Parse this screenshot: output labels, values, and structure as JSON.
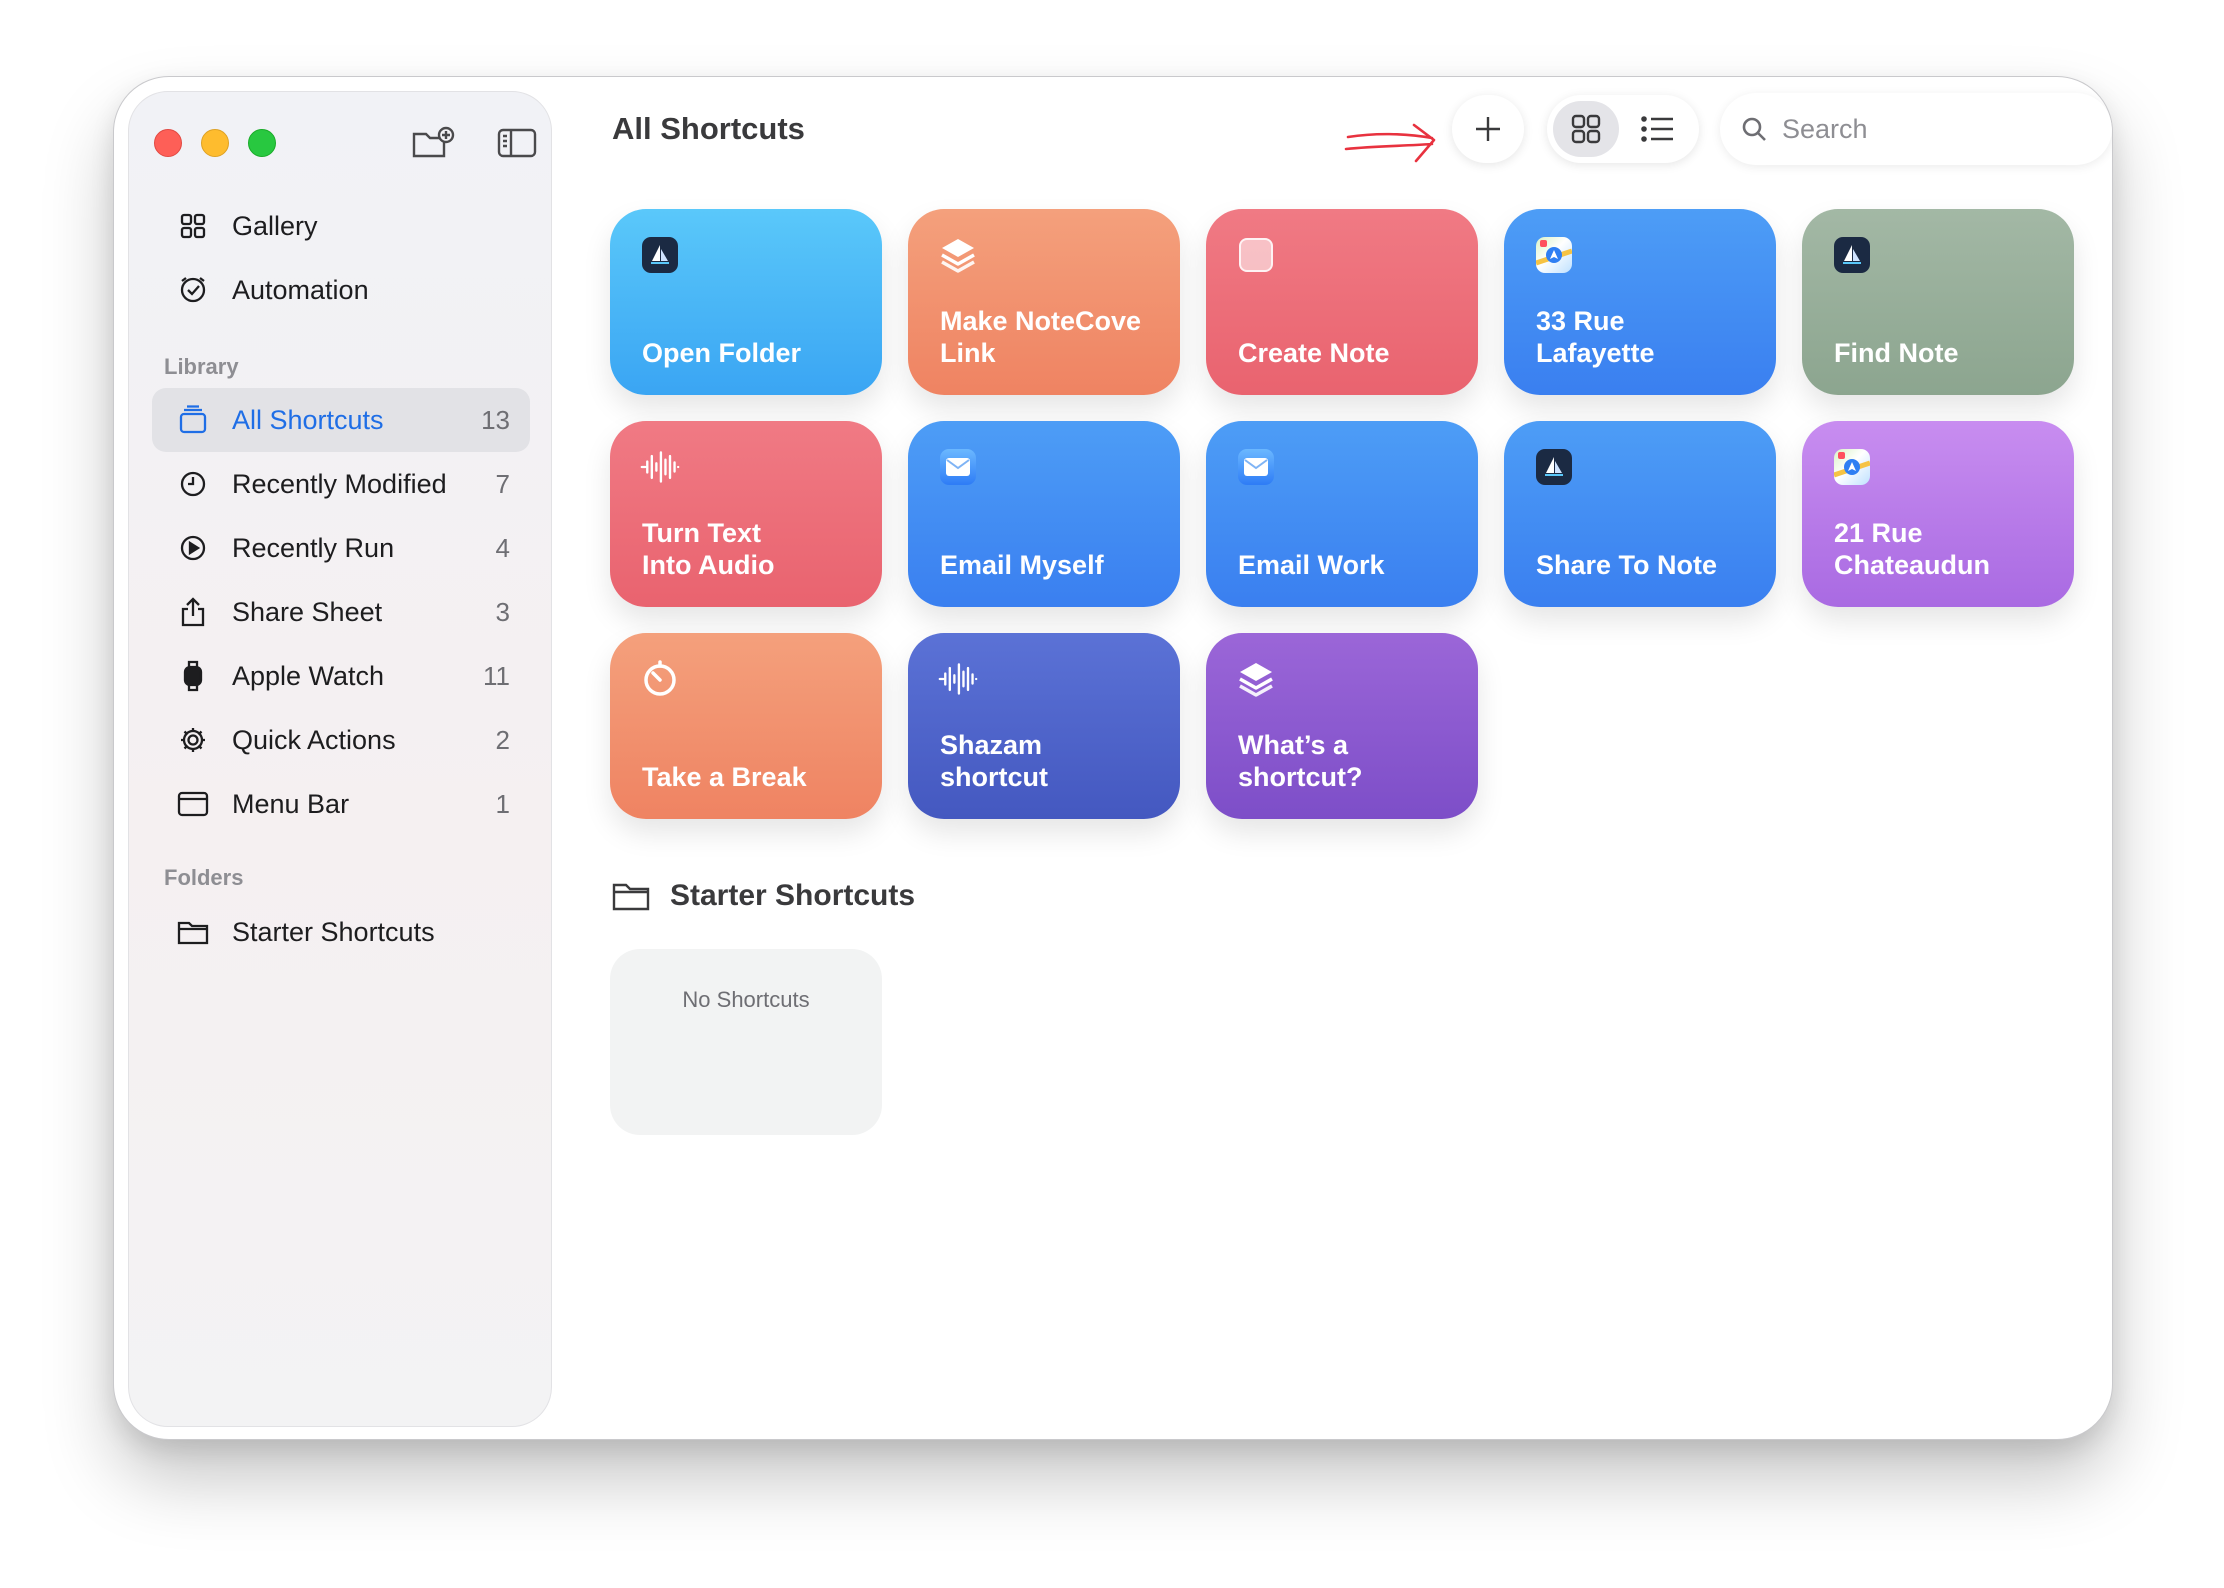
{
  "window": {
    "traffic_lights": [
      "close",
      "minimize",
      "zoom"
    ]
  },
  "sidebar": {
    "toolbar": {
      "new_folder_icon": "folder-badge-plus-icon",
      "toggle_sidebar_icon": "sidebar-left-icon"
    },
    "top_items": [
      {
        "label": "Gallery",
        "icon": "gallery-grid-icon"
      },
      {
        "label": "Automation",
        "icon": "automation-clock-icon"
      }
    ],
    "library_label": "Library",
    "library_items": [
      {
        "label": "All Shortcuts",
        "count": "13",
        "icon": "stack-icon",
        "active": true
      },
      {
        "label": "Recently Modified",
        "count": "7",
        "icon": "clock-icon"
      },
      {
        "label": "Recently Run",
        "count": "4",
        "icon": "play-circle-icon"
      },
      {
        "label": "Share Sheet",
        "count": "3",
        "icon": "share-icon"
      },
      {
        "label": "Apple Watch",
        "count": "11",
        "icon": "watch-icon"
      },
      {
        "label": "Quick Actions",
        "count": "2",
        "icon": "gear-icon"
      },
      {
        "label": "Menu Bar",
        "count": "1",
        "icon": "menu-bar-icon"
      }
    ],
    "folders_label": "Folders",
    "folder_items": [
      {
        "label": "Starter Shortcuts",
        "icon": "folder-icon"
      }
    ]
  },
  "header": {
    "title": "All Shortcuts",
    "annotation_color": "#e8323f",
    "add_icon": "plus-icon",
    "grid_view_icon": "grid-view-icon",
    "list_view_icon": "list-view-icon",
    "search_placeholder": "Search",
    "search_value": ""
  },
  "shortcuts": [
    {
      "label": "Open Folder",
      "color_start": "#5ac8fa",
      "color_end": "#3aa5f3",
      "icon": "sailboat-app-icon"
    },
    {
      "label": "Make NoteCove\nLink",
      "color_start": "#f4a07c",
      "color_end": "#ef8362",
      "icon": "layers-icon"
    },
    {
      "label": "Create Note",
      "color_start": "#f07a84",
      "color_end": "#e9636f",
      "icon": "notes-app-icon"
    },
    {
      "label": "33 Rue\nLafayette",
      "color_start": "#4d9df6",
      "color_end": "#3a7ff0",
      "icon": "maps-app-icon"
    },
    {
      "label": "Find Note",
      "color_start": "#a3b8a5",
      "color_end": "#8ca58f",
      "icon": "sailboat-app-icon"
    },
    {
      "label": "Turn Text\nInto Audio",
      "color_start": "#f07a84",
      "color_end": "#e9636f",
      "icon": "waveform-icon"
    },
    {
      "label": "Email Myself",
      "color_start": "#4d9df6",
      "color_end": "#3a7ff0",
      "icon": "mail-app-icon"
    },
    {
      "label": "Email Work",
      "color_start": "#4d9df6",
      "color_end": "#3a7ff0",
      "icon": "mail-app-icon"
    },
    {
      "label": "Share To Note",
      "color_start": "#4d9df6",
      "color_end": "#3a7ff0",
      "icon": "sailboat-app-icon"
    },
    {
      "label": "21 Rue\nChateaudun",
      "color_start": "#c88df0",
      "color_end": "#a96ae2",
      "icon": "maps-app-icon"
    },
    {
      "label": "Take a Break",
      "color_start": "#f4a07c",
      "color_end": "#ef8362",
      "icon": "timer-icon"
    },
    {
      "label": "Shazam\nshortcut",
      "color_start": "#5b72d6",
      "color_end": "#4458c0",
      "icon": "waveform-icon"
    },
    {
      "label": "What’s a\nshortcut?",
      "color_start": "#9b66d8",
      "color_end": "#7d4ec8",
      "icon": "layers-icon"
    }
  ],
  "folder_section": {
    "title": "Starter Shortcuts",
    "empty_text": "No Shortcuts"
  }
}
